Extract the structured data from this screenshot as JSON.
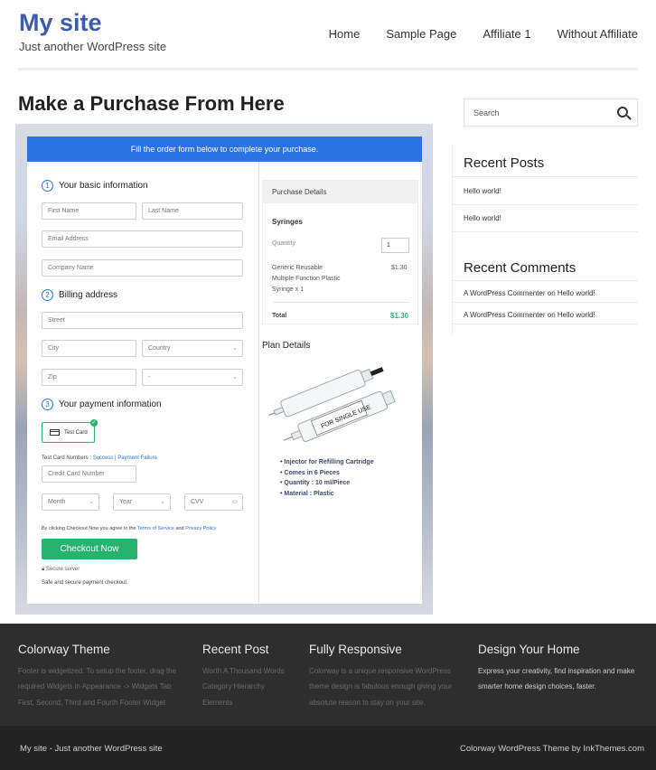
{
  "header": {
    "site_title": "My site",
    "tagline": "Just another WordPress site",
    "nav": [
      "Home",
      "Sample Page",
      "Affiliate 1",
      "Without Affiliate"
    ]
  },
  "main": {
    "page_title": "Make a Purchase From Here",
    "form": {
      "banner": "Fill the order form below to complete your purchase.",
      "sections": [
        {
          "number": "1",
          "title": "Your basic information"
        },
        {
          "number": "2",
          "title": "Billing address"
        },
        {
          "number": "3",
          "title": "Your payment information"
        }
      ],
      "placeholders": {
        "first_name": "First Name",
        "last_name": "Last Name",
        "email": "Email Address",
        "company": "Company Name",
        "street": "Street",
        "city": "City",
        "country": "Country",
        "zip": "Zip",
        "state": "-",
        "card_number": "Credit Card Number",
        "month": "Month",
        "year": "Year",
        "cvv": "CVV"
      },
      "test_card_label": "Test Card",
      "test_card_numbers_prefix": "Test Card Numbers : ",
      "test_success": "Success",
      "test_sep": " | ",
      "test_failure": "Payment Failure",
      "terms_prefix": "By clicking Checkout Now you agree to the ",
      "terms_link": "Terms of Service",
      "terms_and": " and ",
      "privacy_link": "Privacy Policy",
      "checkout_label": "Checkout Now",
      "secure_server": "Secure server",
      "secure_note": "Safe and secure payment checkout."
    },
    "purchase_details": {
      "heading": "Purchase Details",
      "product": "Syringes",
      "quantity_label": "Quantity",
      "quantity_value": "1",
      "item_line1": "Generic Reusable",
      "item_line2": "Multiple Function Plastic",
      "item_line3": "Syringe x 1",
      "item_price": "$1.30",
      "total_label": "Total",
      "total_value": "$1.30"
    },
    "plan": {
      "title": "Plan Details",
      "features": [
        "Injector for Refilling Cartridge",
        "Comes in 6 Pieces",
        "Quantity : 10 ml/Piece",
        "Material : Plastic"
      ],
      "syringe_print": "FOR SINGLE USE"
    }
  },
  "sidebar": {
    "search_placeholder": "Search",
    "recent_posts_title": "Recent Posts",
    "recent_posts": [
      "Hello world!",
      "Hello world!"
    ],
    "recent_comments_title": "Recent Comments",
    "recent_comments": [
      {
        "author": "A WordPress Commenter",
        "on": " on ",
        "post": "Hello world!"
      },
      {
        "author": "A WordPress Commenter",
        "on": " on ",
        "post": "Hello world!"
      }
    ]
  },
  "footer": {
    "columns": [
      {
        "title": "Colorway Theme",
        "text": [
          "Footer is widgetized. To setup the footer, drag the",
          "required Widgets in Appearance -> Widgets Tab",
          "First, Second, Third and Fourth Footer Widget"
        ]
      },
      {
        "title": "Recent Post",
        "text": [
          "Worth A Thousand Words",
          "Category Hierarchy",
          "Elements"
        ]
      },
      {
        "title": "Fully Responsive",
        "text": [
          "Colorway is a unique responsive WordPress",
          "theme design is fabulous enough giving your",
          "absolute reason to stay on your site."
        ]
      },
      {
        "title": "Design Your Home",
        "text": [
          "Express your creativity, find inspiration and make",
          "smarter home design choices, faster."
        ]
      }
    ],
    "bottom_left": "My site - Just another WordPress site",
    "bottom_right": "Colorway WordPress Theme by InkThemes.com"
  },
  "colors": {
    "brand": "#3c5ea8",
    "banner_blue": "#2a73e0",
    "checkout_green": "#27b36f",
    "footer_bg": "#2e2e2e"
  }
}
